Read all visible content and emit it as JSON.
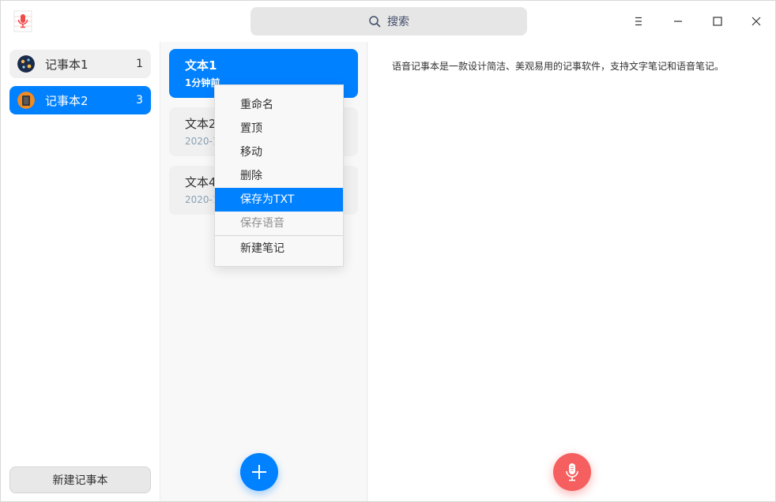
{
  "titlebar": {
    "app_icon": "microphone-notebook-icon",
    "search_placeholder": "搜索",
    "controls": [
      "menu-icon",
      "minimize-icon",
      "maximize-icon",
      "close-icon"
    ]
  },
  "sidebar": {
    "notebooks": [
      {
        "label": "记事本1",
        "count": "1",
        "active": false
      },
      {
        "label": "记事本2",
        "count": "3",
        "active": true
      }
    ],
    "new_notebook_label": "新建记事本"
  },
  "notes": [
    {
      "title": "文本1",
      "time": "1分钟前",
      "active": true
    },
    {
      "title": "文本2",
      "time": "2020-1",
      "active": false
    },
    {
      "title": "文本4",
      "time": "2020-1",
      "active": false
    }
  ],
  "editor": {
    "content": "语音记事本是一款设计简洁、美观易用的记事软件，支持文字笔记和语音笔记。"
  },
  "context_menu": {
    "items": [
      {
        "label": "重命名",
        "state": "normal"
      },
      {
        "label": "置顶",
        "state": "normal"
      },
      {
        "label": "移动",
        "state": "normal"
      },
      {
        "label": "删除",
        "state": "normal"
      },
      {
        "label": "保存为TXT",
        "state": "highlighted"
      },
      {
        "label": "保存语音",
        "state": "disabled"
      },
      {
        "label": "新建笔记",
        "state": "normal"
      }
    ]
  },
  "colors": {
    "accent": "#0081ff",
    "record": "#f55f5f"
  }
}
